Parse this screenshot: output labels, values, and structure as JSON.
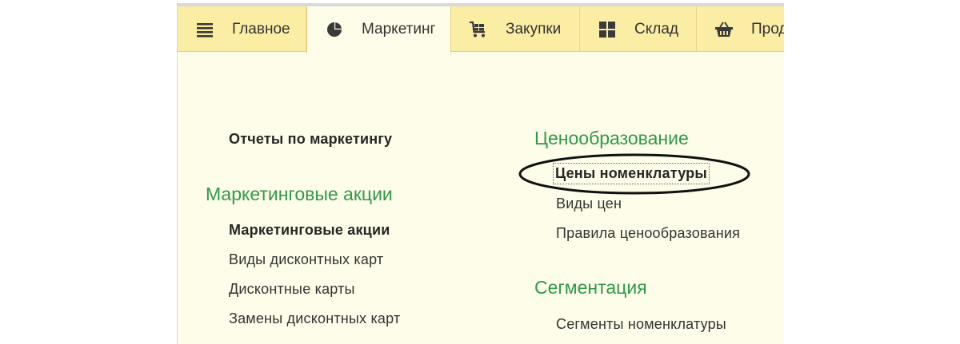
{
  "tabs": [
    {
      "label": "Главное",
      "icon": "menu-lines-icon"
    },
    {
      "label": "Маркетинг",
      "icon": "pie-chart-icon",
      "active": true
    },
    {
      "label": "Закупки",
      "icon": "cart-icon"
    },
    {
      "label": "Склад",
      "icon": "warehouse-grid-icon"
    },
    {
      "label": "Прод",
      "icon": "basket-icon"
    }
  ],
  "left_column": {
    "reports_link": "Отчеты по маркетингу",
    "group_title": "Маркетинговые акции",
    "items": [
      "Маркетинговые акции",
      "Виды дисконтных карт",
      "Дисконтные карты",
      "Замены дисконтных карт"
    ]
  },
  "right_column": {
    "pricing": {
      "title": "Ценообразование",
      "items": [
        "Цены номенклатуры",
        "Виды цен",
        "Правила ценообразования"
      ]
    },
    "segmentation": {
      "title": "Сегментация",
      "items": [
        "Сегменты номенклатуры"
      ]
    }
  },
  "colors": {
    "tab_bar": "#fbeda4",
    "panel_bg": "#fefde9",
    "heading_green": "#2e9a48",
    "text": "#333333"
  }
}
